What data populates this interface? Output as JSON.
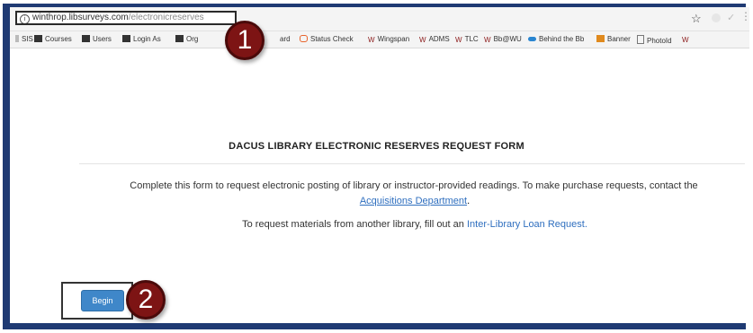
{
  "browser": {
    "url_domain": "winthrop.libsurveys.com",
    "url_path": "/electronicreserves",
    "bookmarks": [
      {
        "label": "SIS",
        "icon": "sis-icon",
        "color": "#555555"
      },
      {
        "label": "Courses",
        "icon": "folder-icon",
        "color": "#333333"
      },
      {
        "label": "Users",
        "icon": "folder-icon",
        "color": "#333333"
      },
      {
        "label": "Login As",
        "icon": "folder-icon",
        "color": "#333333"
      },
      {
        "label": "Org",
        "icon": "folder-icon",
        "color": "#333333"
      },
      {
        "label": "ard",
        "icon": "",
        "color": ""
      },
      {
        "label": "Status Check",
        "icon": "chat-bubble-icon",
        "color": "#e8632b"
      },
      {
        "label": "Wingspan",
        "icon": "winthrop-w-icon",
        "color": "#8b1a1a"
      },
      {
        "label": "ADMS",
        "icon": "winthrop-w-icon",
        "color": "#8b1a1a"
      },
      {
        "label": "TLC",
        "icon": "winthrop-w-icon",
        "color": "#8b1a1a"
      },
      {
        "label": "Bb@WU",
        "icon": "winthrop-w-icon",
        "color": "#8b1a1a"
      },
      {
        "label": "Behind the Bb",
        "icon": "cloud-icon",
        "color": "#2a86d1"
      },
      {
        "label": "Banner",
        "icon": "banner-icon",
        "color": "#e08a1e"
      },
      {
        "label": "PhotoId",
        "icon": "page-icon",
        "color": "#777777"
      }
    ]
  },
  "callouts": [
    "1",
    "2"
  ],
  "page": {
    "title": "DACUS LIBRARY ELECTRONIC RESERVES REQUEST FORM",
    "description": "Complete this form to request electronic posting of library or instructor-provided readings. To make purchase requests, contact the",
    "acquisitions_link": "Acquisitions Department",
    "acquisitions_suffix": ".",
    "ill_prefix": "To request materials from another library, fill out an",
    "ill_link": "Inter-Library Loan Request.",
    "begin_label": "Begin"
  },
  "colors": {
    "frame": "#1f3a73",
    "callout": "#7d1414",
    "link": "#2f6fbf",
    "button": "#3f87c9"
  }
}
